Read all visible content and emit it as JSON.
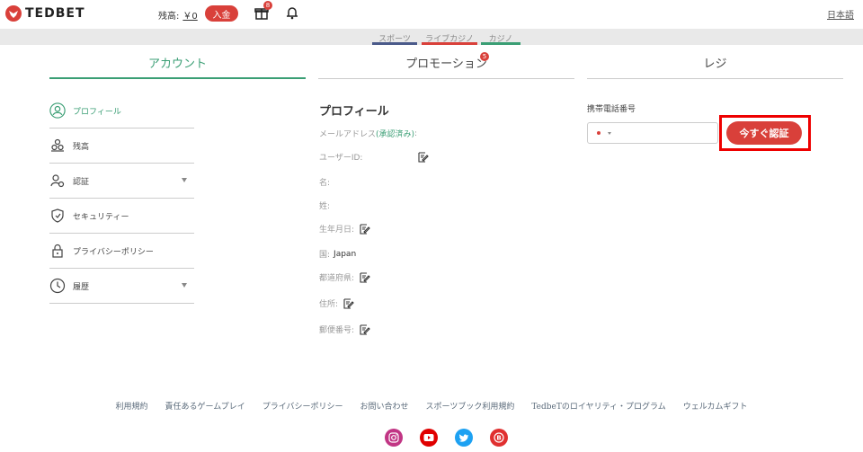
{
  "header": {
    "logo_text": "TEDBET",
    "balance_label": "残高:",
    "balance_value": "￥0",
    "deposit_label": "入金",
    "gift_badge": "8",
    "language": "日本語"
  },
  "nav": {
    "tabs": [
      {
        "label": "スポーツ",
        "color": "#4a5a8a"
      },
      {
        "label": "ライブカジノ",
        "color": "#d9403a"
      },
      {
        "label": "カジノ",
        "color": "#3a9e74"
      }
    ]
  },
  "sections": {
    "account": "アカウント",
    "promotion": "プロモーション",
    "promotion_badge": "5",
    "cashier": "レジ",
    "active_color": "#3a9e74"
  },
  "sidebar": {
    "items": [
      {
        "label": "プロフィール",
        "icon": "user-circle-icon",
        "active": true
      },
      {
        "label": "残高",
        "icon": "coins-icon"
      },
      {
        "label": "認証",
        "icon": "user-check-icon",
        "expandable": true
      },
      {
        "label": "セキュリティー",
        "icon": "shield-icon"
      },
      {
        "label": "プライバシーポリシー",
        "icon": "lock-icon"
      },
      {
        "label": "履歴",
        "icon": "history-icon",
        "expandable": true
      }
    ]
  },
  "profile": {
    "title": "プロフィール",
    "email_label": "メールアドレス",
    "email_status": "(承認済み)",
    "email_colon": ":",
    "user_id_label": "ユーザーID:",
    "first_name_label": "名:",
    "last_name_label": "姓:",
    "birthdate_label": "生年月日:",
    "country_label": "国:",
    "country_value": "Japan",
    "prefecture_label": "都道府県:",
    "address_label": "住所:",
    "postal_label": "郵便番号:"
  },
  "cashier": {
    "phone_label": "携帯電話番号",
    "verify_button": "今すぐ認証"
  },
  "footer": {
    "links": [
      "利用規約",
      "責任あるゲームプレイ",
      "プライバシーポリシー",
      "お問い合わせ",
      "スポーツブック利用規約",
      "TedbeTのロイヤリティ・プログラム",
      "ウェルカムギフト"
    ],
    "social": [
      {
        "name": "instagram-icon",
        "color": "#c13584"
      },
      {
        "name": "youtube-icon",
        "color": "#e00000"
      },
      {
        "name": "twitter-icon",
        "color": "#1da1f2"
      },
      {
        "name": "blog-icon",
        "color": "#e03030"
      }
    ]
  }
}
